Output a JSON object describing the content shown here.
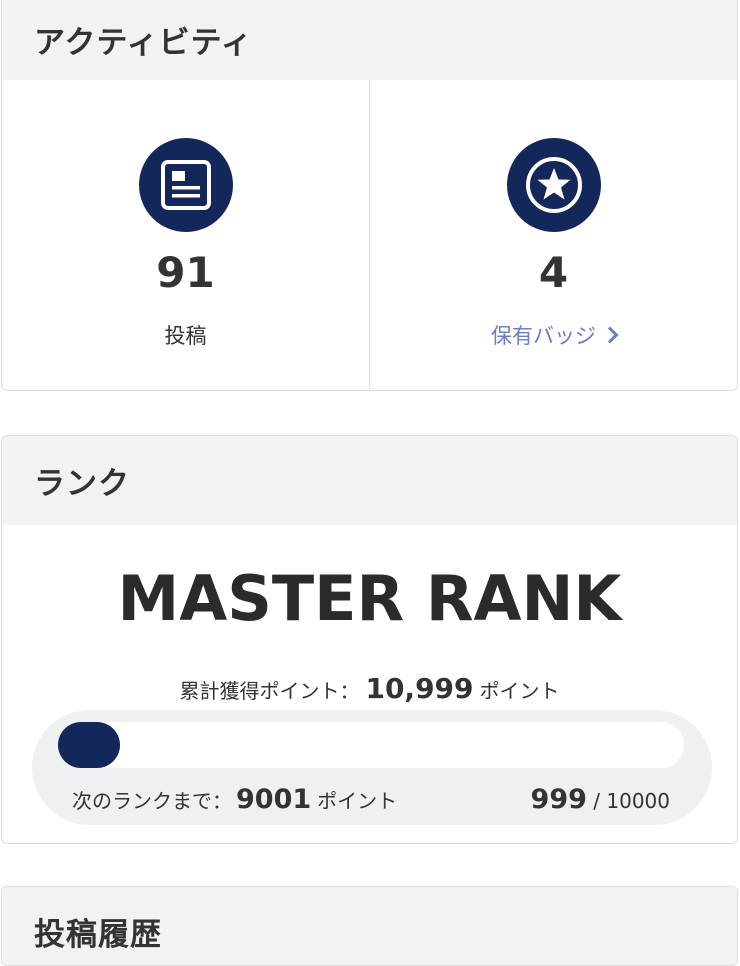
{
  "activity": {
    "title": "アクティビティ",
    "posts": {
      "value": "91",
      "label": "投稿"
    },
    "badges": {
      "value": "4",
      "label": "保有バッジ"
    }
  },
  "rank": {
    "title": "ランク",
    "name": "MASTER RANK",
    "total_points_label": "累計獲得ポイント：",
    "total_points": "10,999",
    "points_unit": "ポイント",
    "next_rank_label": "次のランクまで：",
    "next_rank_points": "9001",
    "progress_current": "999",
    "progress_separator": " / ",
    "progress_max": "10000",
    "progress_fraction": 0.0999
  },
  "history": {
    "title": "投稿履歴"
  },
  "colors": {
    "accent": "#13275a",
    "link": "#6a7ec5",
    "header_bg": "#f3f2f1"
  }
}
